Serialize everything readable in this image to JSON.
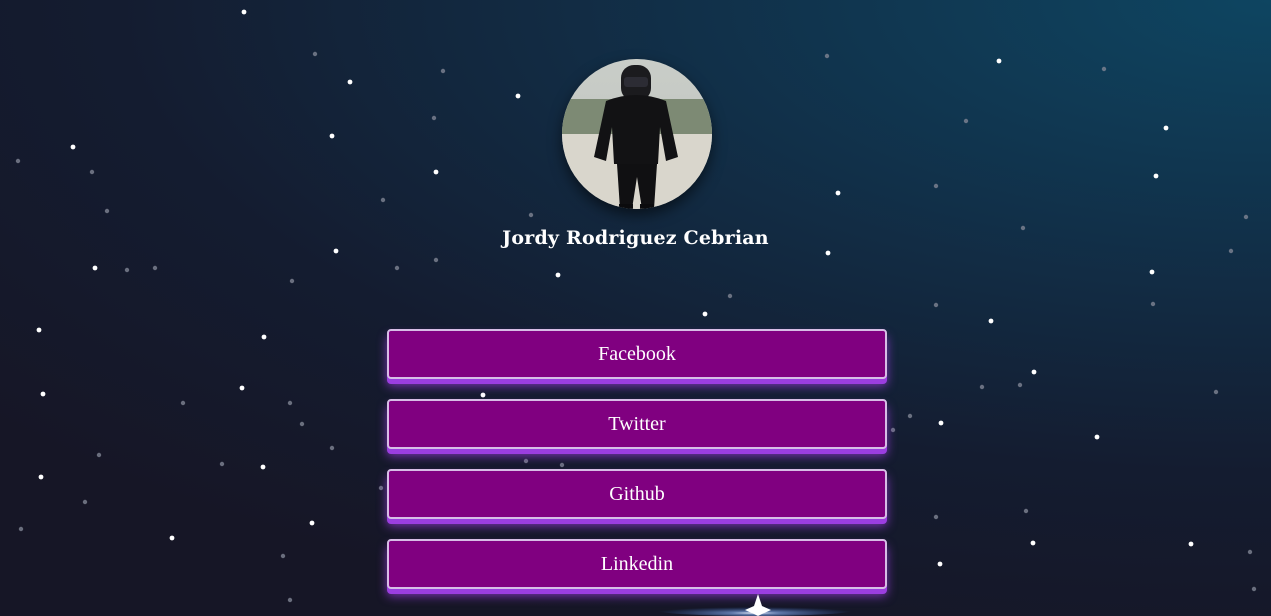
{
  "profile": {
    "name": "Jordy Rodriguez Cebrian",
    "avatar_alt": "profile photo"
  },
  "links": [
    {
      "label": "Facebook"
    },
    {
      "label": "Twitter"
    },
    {
      "label": "Github"
    },
    {
      "label": "Linkedin"
    }
  ],
  "colors": {
    "button_bg": "#800080",
    "button_border": "#d7bde6",
    "button_glow": "#9b3ee0",
    "background_dark": "#161626",
    "background_accent": "#0e4561"
  }
}
